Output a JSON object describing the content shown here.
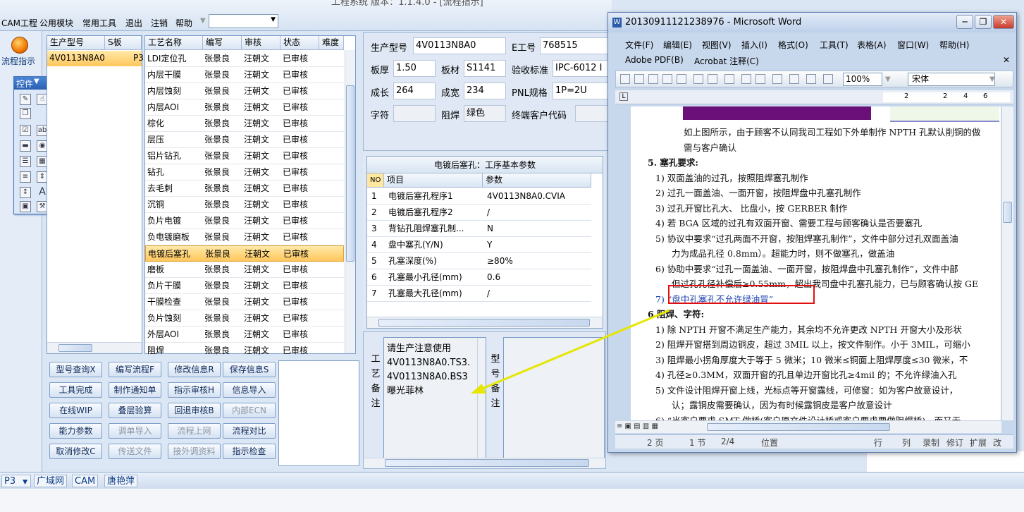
{
  "window_title": "工程系统   版本：1.1.4.0 - [流程指示]",
  "menu": {
    "items": [
      "CAM工程",
      "公用模块",
      "常用工具",
      "退出",
      "注销",
      "帮助"
    ],
    "combo_value": ""
  },
  "nav": {
    "label": "流程指示"
  },
  "toolbox": {
    "title": "控件"
  },
  "left_grid": {
    "headers": [
      "生产型号",
      "S板"
    ],
    "row": {
      "model": "4V0113N8A0",
      "s": "P3"
    }
  },
  "proc_grid": {
    "headers": [
      "工艺名称",
      "编写",
      "审核",
      "状态",
      "难度"
    ],
    "rows": [
      [
        "LDI定位孔",
        "张景良",
        "汪朝文",
        "已审核"
      ],
      [
        "内层干膜",
        "张景良",
        "汪朝文",
        "已审核"
      ],
      [
        "内层蚀刻",
        "张景良",
        "汪朝文",
        "已审核"
      ],
      [
        "内层AOI",
        "张景良",
        "汪朝文",
        "已审核"
      ],
      [
        "棕化",
        "张景良",
        "汪朝文",
        "已审核"
      ],
      [
        "层压",
        "张景良",
        "汪朝文",
        "已审核"
      ],
      [
        "铝片钻孔",
        "张景良",
        "汪朝文",
        "已审核"
      ],
      [
        "钻孔",
        "张景良",
        "汪朝文",
        "已审核"
      ],
      [
        "去毛刺",
        "张景良",
        "汪朝文",
        "已审核"
      ],
      [
        "沉铜",
        "张景良",
        "汪朝文",
        "已审核"
      ],
      [
        "负片电镀",
        "张景良",
        "汪朝文",
        "已审核"
      ],
      [
        "负电镀磨板",
        "张景良",
        "汪朝文",
        "已审核"
      ],
      [
        "电镀后塞孔",
        "张景良",
        "汪朝文",
        "已审核"
      ],
      [
        "磨板",
        "张景良",
        "汪朝文",
        "已审核"
      ],
      [
        "负片干膜",
        "张景良",
        "汪朝文",
        "已审核"
      ],
      [
        "干膜检查",
        "张景良",
        "汪朝文",
        "已审核"
      ],
      [
        "负片蚀刻",
        "张景良",
        "汪朝文",
        "已审核"
      ],
      [
        "外层AOI",
        "张景良",
        "汪朝文",
        "已审核"
      ],
      [
        "阻焊",
        "张景良",
        "汪朝文",
        "已审核"
      ]
    ]
  },
  "buttons": [
    [
      "型号查询X",
      "编写流程F",
      "修改信息R",
      "保存信息S"
    ],
    [
      "工具完成",
      "制作通知单",
      "指示审核H",
      "信息导入"
    ],
    [
      "在线WIP",
      "叠层验算",
      "回退审核B",
      "内部ECN"
    ],
    [
      "能力参数",
      "调单导入",
      "流程上网",
      "流程对比"
    ],
    [
      "取消修改C",
      "传送文件",
      "接外调资料",
      "指示检查"
    ]
  ],
  "info": {
    "model_label": "生产型号",
    "model": "4V0113N8A0",
    "eno_label": "E工号",
    "eno": "768515",
    "thick_label": "板厚",
    "thick": "1.50",
    "mat_label": "板材",
    "mat": "S1141",
    "std_label": "验收标准",
    "std": "IPC-6012 I",
    "len_label": "成长",
    "len": "264",
    "wid_label": "成宽",
    "wid": "234",
    "pnl_label": "PNL规格",
    "pnl": "1P=2U",
    "char_label": "字符",
    "char": "",
    "mask_label": "阻焊",
    "mask": "绿色",
    "cust_label": "终端客户代码",
    "cust": ""
  },
  "params": {
    "title": "电镀后塞孔：工序基本参数",
    "headers": [
      "NO",
      "项目",
      "参数"
    ],
    "rows": [
      [
        "1",
        "电镀后塞孔程序1",
        "4V0113N8A0.CVIA"
      ],
      [
        "2",
        "电镀后塞孔程序2",
        "/"
      ],
      [
        "3",
        "背钻孔阻焊塞孔制...",
        "N"
      ],
      [
        "4",
        "盘中塞孔(Y/N)",
        "Y"
      ],
      [
        "5",
        "孔塞深度(%)",
        "≥80%"
      ],
      [
        "6",
        "孔塞最小孔径(mm)",
        "0.6"
      ],
      [
        "7",
        "孔塞最大孔径(mm)",
        "/"
      ]
    ]
  },
  "notes": {
    "label": [
      "工",
      "艺",
      "备",
      "注"
    ],
    "lines": [
      "请生产注意使用",
      "4V0113N8A0.TS3.",
      "4V0113N8A0.BS3",
      "曝光菲林"
    ],
    "label2": [
      "型",
      "号",
      "备",
      "注"
    ]
  },
  "statusbar": {
    "items": [
      "P3",
      "广域网",
      "CAM",
      "唐艳萍"
    ]
  },
  "word": {
    "title": "20130911121238976 - Microsoft Word",
    "menu1": [
      "文件(F)",
      "编辑(E)",
      "视图(V)",
      "插入(I)",
      "格式(O)",
      "工具(T)",
      "表格(A)",
      "窗口(W)",
      "帮助(H)"
    ],
    "menu2": [
      "Adobe PDF(B)",
      "Acrobat 注释(C)"
    ],
    "zoom": "100%",
    "font": "宋体",
    "ruler": [
      "2",
      "2",
      "4",
      "6"
    ],
    "lines": [
      "如上图所示，由于顾客不认同我司工程如下外单制作 NPTH 孔默认削铜的做",
      "需与客户确认",
      "5.   塞孔要求:",
      "1)  双面盖油的过孔，按照阻焊塞孔制作",
      "2)  过孔一面盖油、一面开窗，按阻焊盘中孔塞孔制作",
      "3)  过孔开窗比孔大、 比盘小，按 GERBER 制作",
      "4)  若 BGA 区域的过孔有双面开窗、需要工程与顾客确认是否要塞孔",
      "5)  协议中要求“过孔两面不开窗，按阻焊塞孔制作”，文件中部分过孔双面盖油",
      "力为成品孔径 0.8mm）。超能力时，则不做塞孔，做盖油",
      "6)  协助中要求“过孔一面盖油、一面开窗，按阻焊盘中孔塞孔制作”，文件中部",
      "但过孔孔径补偿后≥0.55mm，超出我司盘中孔塞孔能力，已与顾客确认按 GE",
      "7)  “盘中孔塞孔不允许绿油冒”",
      "6   阻焊、字符:",
      "1)  除 NPTH 开窗不满足生产能力，其余均不允许更改 NPTH 开窗大小及形状",
      "2)  阻焊开窗搭到周边铜皮，超过 3MIL 以上，按文件制作。小于 3MIL，可缩小",
      "3)  阻焊最小拐角厚度大于等于 5 微米；10 微米≤铜面上阻焊厚度≤30 微米，不",
      "4)  孔径≥0.3MM，双面开窗的孔且单边开窗比孔≥4mil 的；不允许绿油入孔",
      "5)  文件设计阻焊开窗上线，光标点等开窗露线，可修窗：如为客户故意设计，",
      "认；露铜皮需要确认，因为有时候露铜皮是客户故意设计",
      "6)  “当客户要求 SMT 做桥(客户原文件设计桥或客户要求要做阻焊桥)，而又无"
    ],
    "status": [
      "2 页",
      "1 节",
      "2/4",
      "位置",
      "行",
      "列",
      "录制",
      "修订",
      "扩展",
      "改"
    ]
  }
}
